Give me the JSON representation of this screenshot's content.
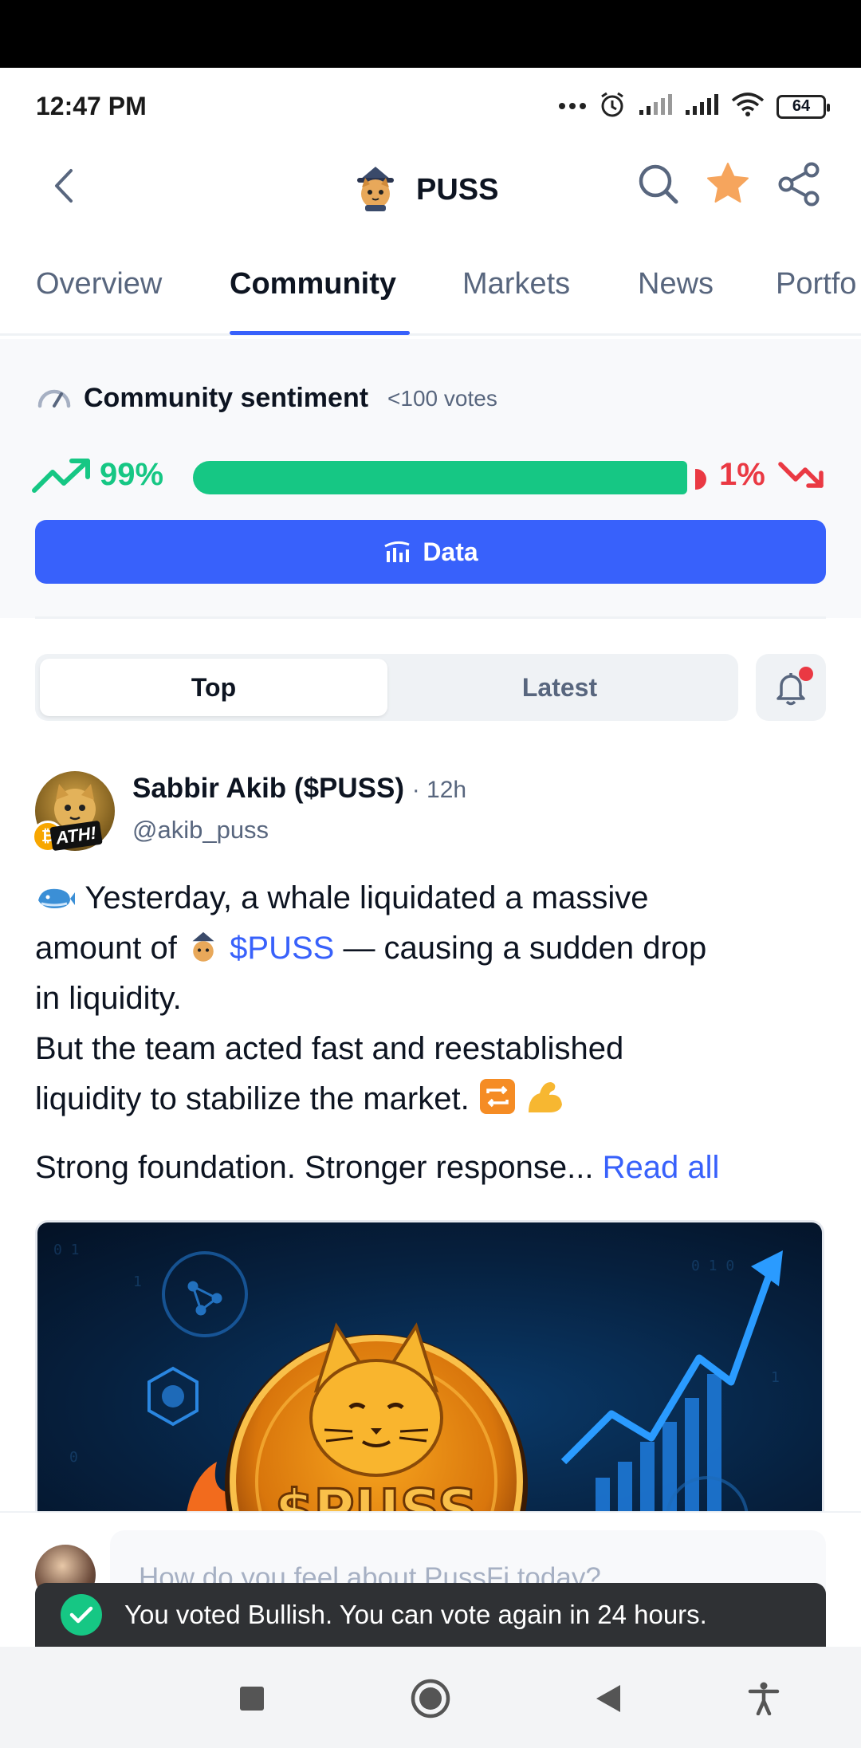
{
  "status_bar": {
    "time": "12:47 PM",
    "battery": "64"
  },
  "header": {
    "coin_name": "PUSS"
  },
  "tabs": [
    "Overview",
    "Community",
    "Markets",
    "News",
    "Portfo"
  ],
  "sentiment": {
    "title": "Community sentiment",
    "votes": "<100 votes",
    "bullish_pct": "99%",
    "bearish_pct": "1%",
    "bullish_fraction": 0.99,
    "data_button": "Data"
  },
  "feed_toggle": {
    "top": "Top",
    "latest": "Latest"
  },
  "post": {
    "author": "Sabbir Akib ($PUSS)",
    "time": "· 12h",
    "handle": "@akib_puss",
    "badge": "ATH!",
    "line1a": "Yesterday, a whale liquidated a massive",
    "line2a": "amount of",
    "cashtag": "$PUSS",
    "line2b": "— causing a sudden drop",
    "line3": "in liquidity.",
    "line4": "But the team acted fast and reestablished",
    "line5": "liquidity to stabilize the market.",
    "line6": "Strong foundation. Stronger response...",
    "read_all": "Read all",
    "image_text": "$PUSS"
  },
  "composer": {
    "placeholder": "How do you feel about PussFi today?"
  },
  "toast": {
    "message": "You voted Bullish. You can vote again in 24 hours."
  },
  "colors": {
    "bull": "#16c784",
    "bear": "#ea3943",
    "accent": "#3861fb"
  },
  "icons": [
    "back-arrow-icon",
    "search-icon",
    "star-icon",
    "share-icon",
    "gauge-icon",
    "trend-up-icon",
    "trend-down-icon",
    "bar-chart-icon",
    "bell-icon",
    "check-icon",
    "recents-icon",
    "home-icon",
    "back-icon",
    "accessibility-icon"
  ]
}
